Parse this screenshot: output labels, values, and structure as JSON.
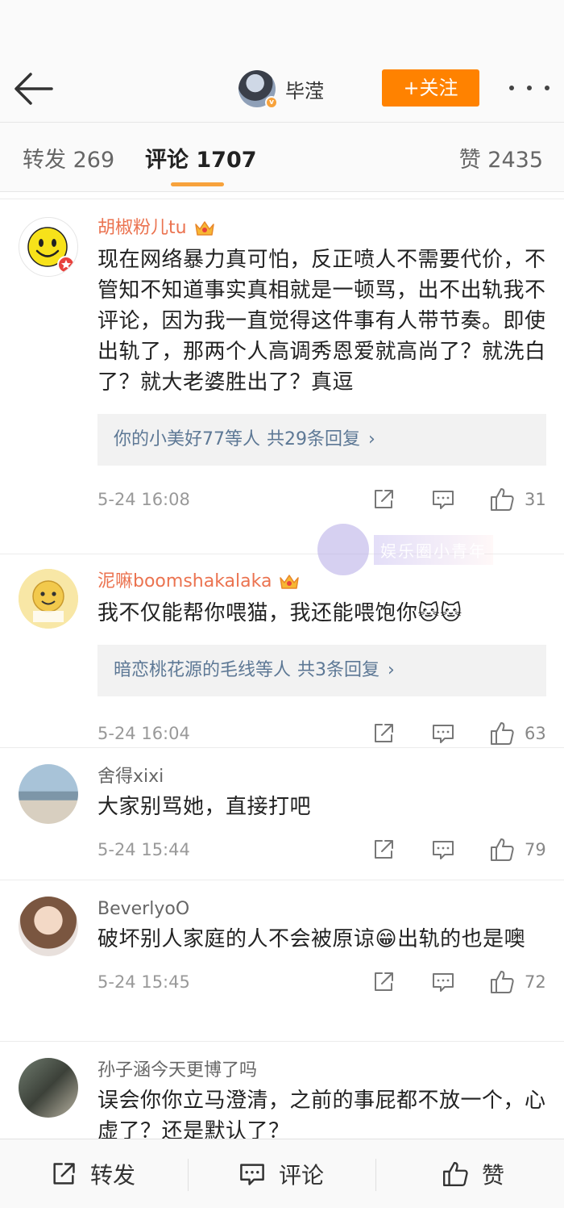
{
  "header": {
    "author_name": "毕滢",
    "follow_label": "+关注",
    "verified_badge": "v"
  },
  "tabs": [
    {
      "label": "转发 269"
    },
    {
      "label": "评论 1707"
    },
    {
      "label": "赞 2435"
    }
  ],
  "accent_color": "#ff8200",
  "comments": [
    {
      "username": "胡椒粉儿tu",
      "text": "现在网络暴力真可怕，反正喷人不需要代价，不管知不知道事实真相就是一顿骂，出不出轨我不评论，因为我一直觉得这件事有人带节奏。即使出轨了，那两个人高调秀恩爱就高尚了？就洗白了？就大老婆胜出了？真逗",
      "reply_users": "你的小美好77等人",
      "reply_count": "共29条回复",
      "time": "5-24 16:08",
      "likes": "31"
    },
    {
      "username": "泥嘛boomshakalaka",
      "text": "我不仅能帮你喂猫，我还能喂饱你🐱🐱",
      "reply_users": "暗恋桃花源的毛线等人",
      "reply_count": "共3条回复",
      "time": "5-24 16:04",
      "likes": "63"
    },
    {
      "username": "舍得xixi",
      "text": "大家别骂她，直接打吧",
      "time": "5-24 15:44",
      "likes": "79"
    },
    {
      "username": "BeverlyoO",
      "text": "破坏别人家庭的人不会被原谅😁出轨的也是噢",
      "time": "5-24 15:45",
      "likes": "72"
    },
    {
      "username": "孙子涵今天更博了吗",
      "text": "误会你你立马澄清，之前的事屁都不放一个，心虚了？还是默认了？"
    }
  ],
  "watermark": "娱乐圈小青年",
  "bottom_bar": {
    "share_label": "转发",
    "comment_label": "评论",
    "like_label": "赞"
  }
}
